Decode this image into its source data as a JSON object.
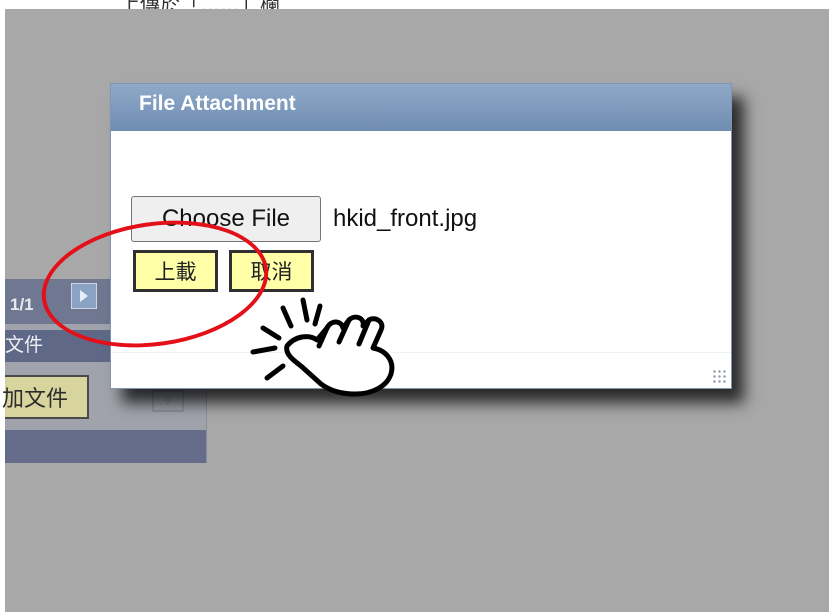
{
  "background": {
    "top_partial_text": "上傳於「……」欄",
    "pager": {
      "label": "1/1"
    },
    "header": "文件",
    "add_button": "加文件",
    "plus_label": "+"
  },
  "dialog": {
    "title": "File Attachment",
    "choose_file_label": "Choose File",
    "selected_file": "hkid_front.jpg",
    "upload_label": "上載",
    "cancel_label": "取消"
  },
  "annotations": {
    "ellipse_color": "#e3101a",
    "cursor_icon": "hand-pointer-icon"
  }
}
